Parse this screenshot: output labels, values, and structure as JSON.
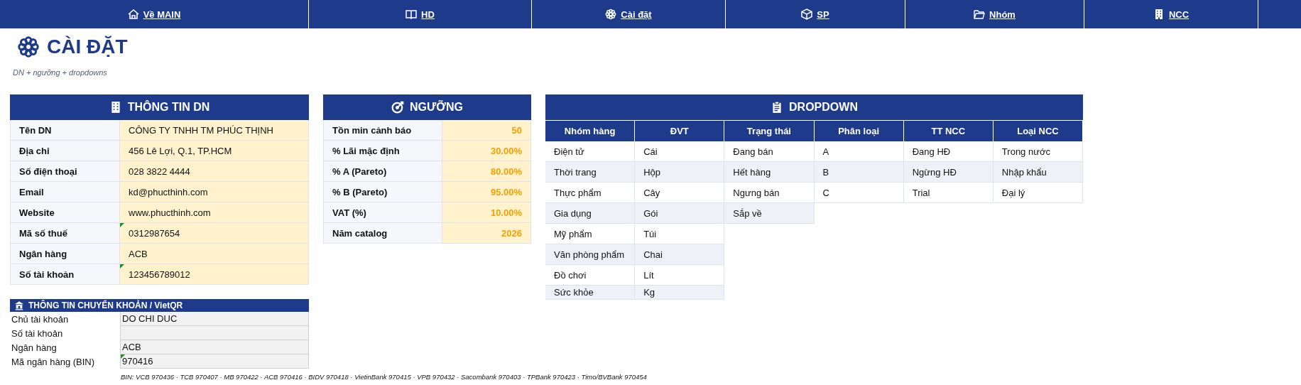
{
  "nav": [
    {
      "label": "Về MAIN"
    },
    {
      "label": "HD"
    },
    {
      "label": "Cài đặt"
    },
    {
      "label": "SP"
    },
    {
      "label": "Nhóm"
    },
    {
      "label": "NCC"
    }
  ],
  "page": {
    "title": "CÀI ĐẶT",
    "subtitle": "DN + ngưỡng + dropdowns"
  },
  "company": {
    "title": "THÔNG TIN DN",
    "rows": [
      {
        "label": "Tên DN",
        "value": "CÔNG TY TNHH TM PHÚC THỊNH",
        "note_marker": false
      },
      {
        "label": "Địa chỉ",
        "value": "456 Lê Lợi, Q.1, TP.HCM",
        "note_marker": false
      },
      {
        "label": "Số điện thoại",
        "value": "028 3822 4444",
        "note_marker": false
      },
      {
        "label": "Email",
        "value": "kd@phucthinh.com",
        "note_marker": false
      },
      {
        "label": "Website",
        "value": "www.phucthinh.com",
        "note_marker": false
      },
      {
        "label": "Mã số thuế",
        "value": "0312987654",
        "note_marker": true
      },
      {
        "label": "Ngân hàng",
        "value": "ACB",
        "note_marker": false
      },
      {
        "label": "Số tài khoản",
        "value": "123456789012",
        "note_marker": true
      }
    ]
  },
  "thresholds": {
    "title": "NGƯỠNG",
    "rows": [
      {
        "label": "Tồn min cảnh báo",
        "value": "50"
      },
      {
        "label": "% Lãi mặc định",
        "value": "30.00%"
      },
      {
        "label": "% A (Pareto)",
        "value": "80.00%"
      },
      {
        "label": "% B (Pareto)",
        "value": "95.00%"
      },
      {
        "label": "VAT (%)",
        "value": "10.00%"
      },
      {
        "label": "Năm catalog",
        "value": "2026"
      }
    ]
  },
  "dropdown": {
    "title": "DROPDOWN",
    "columns": [
      {
        "header": "Nhóm hàng",
        "items": [
          "Điện tử",
          "Thời trang",
          "Thực phẩm",
          "Gia dụng",
          "Mỹ phẩm",
          "Văn phòng phẩm",
          "Đồ chơi",
          "Sức khỏe"
        ]
      },
      {
        "header": "ĐVT",
        "items": [
          "Cái",
          "Hộp",
          "Cây",
          "Gói",
          "Túi",
          "Chai",
          "Lít",
          "Kg"
        ]
      },
      {
        "header": "Trạng thái",
        "items": [
          "Đang bán",
          "Hết hàng",
          "Ngưng bán",
          "Sắp về"
        ]
      },
      {
        "header": "Phân loại",
        "items": [
          "A",
          "B",
          "C"
        ]
      },
      {
        "header": "TT NCC",
        "items": [
          "Đang HĐ",
          "Ngừng HĐ",
          "Trial"
        ]
      },
      {
        "header": "Loại NCC",
        "items": [
          "Trong nước",
          "Nhập khẩu",
          "Đại lý"
        ]
      }
    ]
  },
  "transfer": {
    "title": "THÔNG TIN CHUYỂN KHOẢN / VietQR",
    "rows": [
      {
        "label": "Chủ tài khoản",
        "value": "DO CHI DUC",
        "note_marker": false
      },
      {
        "label": "Số tài khoản",
        "note_marker": false
      },
      {
        "label": "Ngân hàng",
        "value": "ACB",
        "note_marker": false
      },
      {
        "label": "Mã ngân hàng (BIN)",
        "value": "970416",
        "note_marker": true
      }
    ],
    "note": "BIN: VCB 970436 · TCB 970407 · MB 970422 · ACB 970416 · BIDV 970418 · VietinBank 970415 · VPB 970432 · Sacombank 970403 · TPBank 970423 · Timo/BVBank 970454"
  }
}
